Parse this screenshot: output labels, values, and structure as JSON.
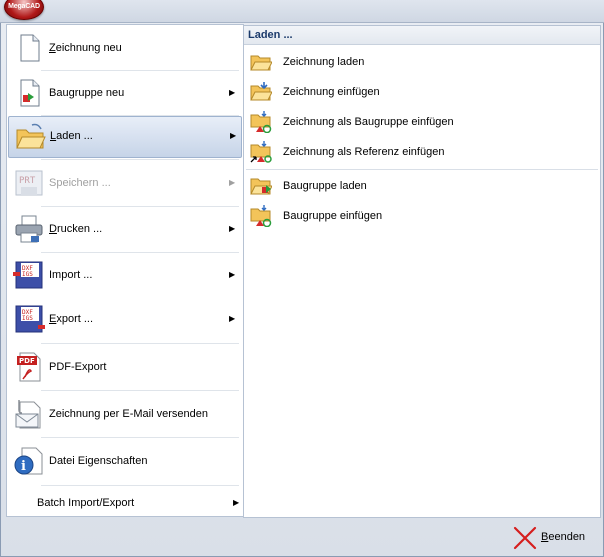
{
  "app": {
    "logo_text": "MegaCAD"
  },
  "left_menu": [
    {
      "label": "Zeichnung neu",
      "underline": "Z",
      "rest": "eichnung neu",
      "icon": "new-document-icon",
      "has_submenu": false,
      "enabled": true
    },
    {
      "label": "Baugruppe neu",
      "underline": "",
      "rest": "Baugruppe neu",
      "icon": "new-assembly-icon",
      "has_submenu": true,
      "enabled": true
    },
    {
      "label": "Laden ...",
      "underline": "L",
      "rest": "aden ...",
      "icon": "open-folder-icon",
      "has_submenu": true,
      "enabled": true,
      "selected": true
    },
    {
      "label": "Speichern ...",
      "underline": "",
      "rest": "Speichern ...",
      "icon": "save-prt-icon",
      "has_submenu": true,
      "enabled": false
    },
    {
      "label": "Drucken ...",
      "underline": "D",
      "rest": "rucken ...",
      "icon": "printer-icon",
      "has_submenu": true,
      "enabled": true
    },
    {
      "label": "Import ...",
      "underline": "",
      "rest": "Import ...",
      "icon": "import-dxf-igs-icon",
      "has_submenu": true,
      "enabled": true
    },
    {
      "label": "Export ...",
      "underline": "E",
      "rest": "xport ...",
      "icon": "export-dxf-igs-icon",
      "has_submenu": true,
      "enabled": true
    },
    {
      "label": "PDF-Export",
      "underline": "",
      "rest": "PDF-Export",
      "icon": "pdf-icon",
      "has_submenu": false,
      "enabled": true
    },
    {
      "label": "Zeichnung per E-Mail versenden",
      "underline": "",
      "rest": "Zeichnung per E-Mail versenden",
      "icon": "email-icon",
      "has_submenu": false,
      "enabled": true
    },
    {
      "label": "Datei Eigenschaften",
      "underline": "",
      "rest": "Datei Eigenschaften",
      "icon": "properties-icon",
      "has_submenu": false,
      "enabled": true
    },
    {
      "label": "Batch Import/Export",
      "underline": "",
      "rest": "Batch Import/Export",
      "icon": "",
      "has_submenu": true,
      "enabled": true
    }
  ],
  "submenu": {
    "title": "Laden ...",
    "items": [
      {
        "label": "Zeichnung laden",
        "icon": "open-folder-icon"
      },
      {
        "label": "Zeichnung einfügen",
        "icon": "insert-folder-icon"
      },
      {
        "label": "Zeichnung als Baugruppe einfügen",
        "icon": "insert-assembly-icon"
      },
      {
        "label": "Zeichnung als Referenz einfügen",
        "icon": "insert-reference-icon"
      },
      {
        "label": "Baugruppe laden",
        "icon": "load-assembly-icon"
      },
      {
        "label": "Baugruppe einfügen",
        "icon": "insert-assembly-icon"
      }
    ]
  },
  "footer": {
    "exit_label": "Beenden",
    "exit_underline": "B",
    "exit_rest": "eenden",
    "exit_icon": "red-x-icon"
  },
  "colors": {
    "accent": "#1b3a6b",
    "highlight": "#c6d4e8",
    "exit_red": "#d61e1e"
  }
}
